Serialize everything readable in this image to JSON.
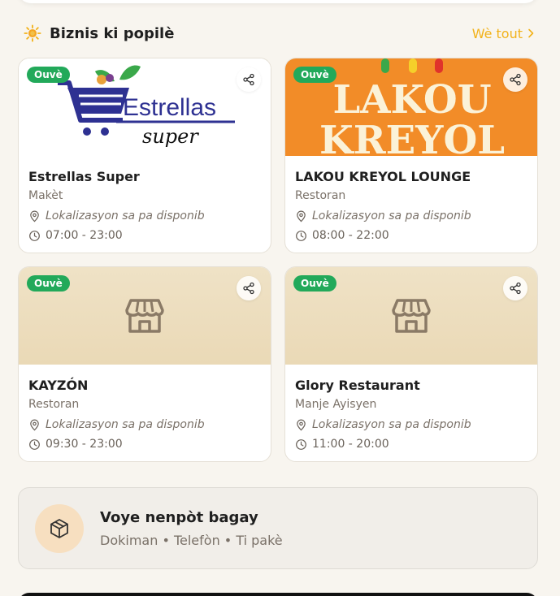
{
  "section": {
    "title": "Biznis ki popilè",
    "see_all_label": "Wè tout"
  },
  "colors": {
    "accent": "#f2b21a",
    "open_badge": "#22a95a",
    "card_border": "#e5e0d6",
    "page_bg": "#f8f5ef"
  },
  "businesses": [
    {
      "name": "Estrellas Super",
      "category": "Makèt",
      "status": "Ouvè",
      "location": "Lokalizasyon sa pa disponib",
      "hours": "07:00 - 23:00",
      "logo": {
        "word1": "Estrellas",
        "word2": "super"
      }
    },
    {
      "name": "LAKOU KREYOL LOUNGE",
      "category": "Restoran",
      "status": "Ouvè",
      "location": "Lokalizasyon sa pa disponib",
      "hours": "08:00 - 22:00",
      "logo": {
        "line1": "LAKOU",
        "line2": "KREYOL"
      }
    },
    {
      "name": "KAYZÓN",
      "category": "Restoran",
      "status": "Ouvè",
      "location": "Lokalizasyon sa pa disponib",
      "hours": "09:30 - 23:00",
      "icon": "storefront-icon"
    },
    {
      "name": "Glory Restaurant",
      "category": "Manje Ayisyen",
      "status": "Ouvè",
      "location": "Lokalizasyon sa pa disponib",
      "hours": "11:00 - 20:00",
      "icon": "storefront-icon"
    }
  ],
  "send_anything": {
    "title": "Voye nenpòt bagay",
    "subtitle": "Dokiman • Telefòn • Ti pakè",
    "icon": "package-icon"
  }
}
